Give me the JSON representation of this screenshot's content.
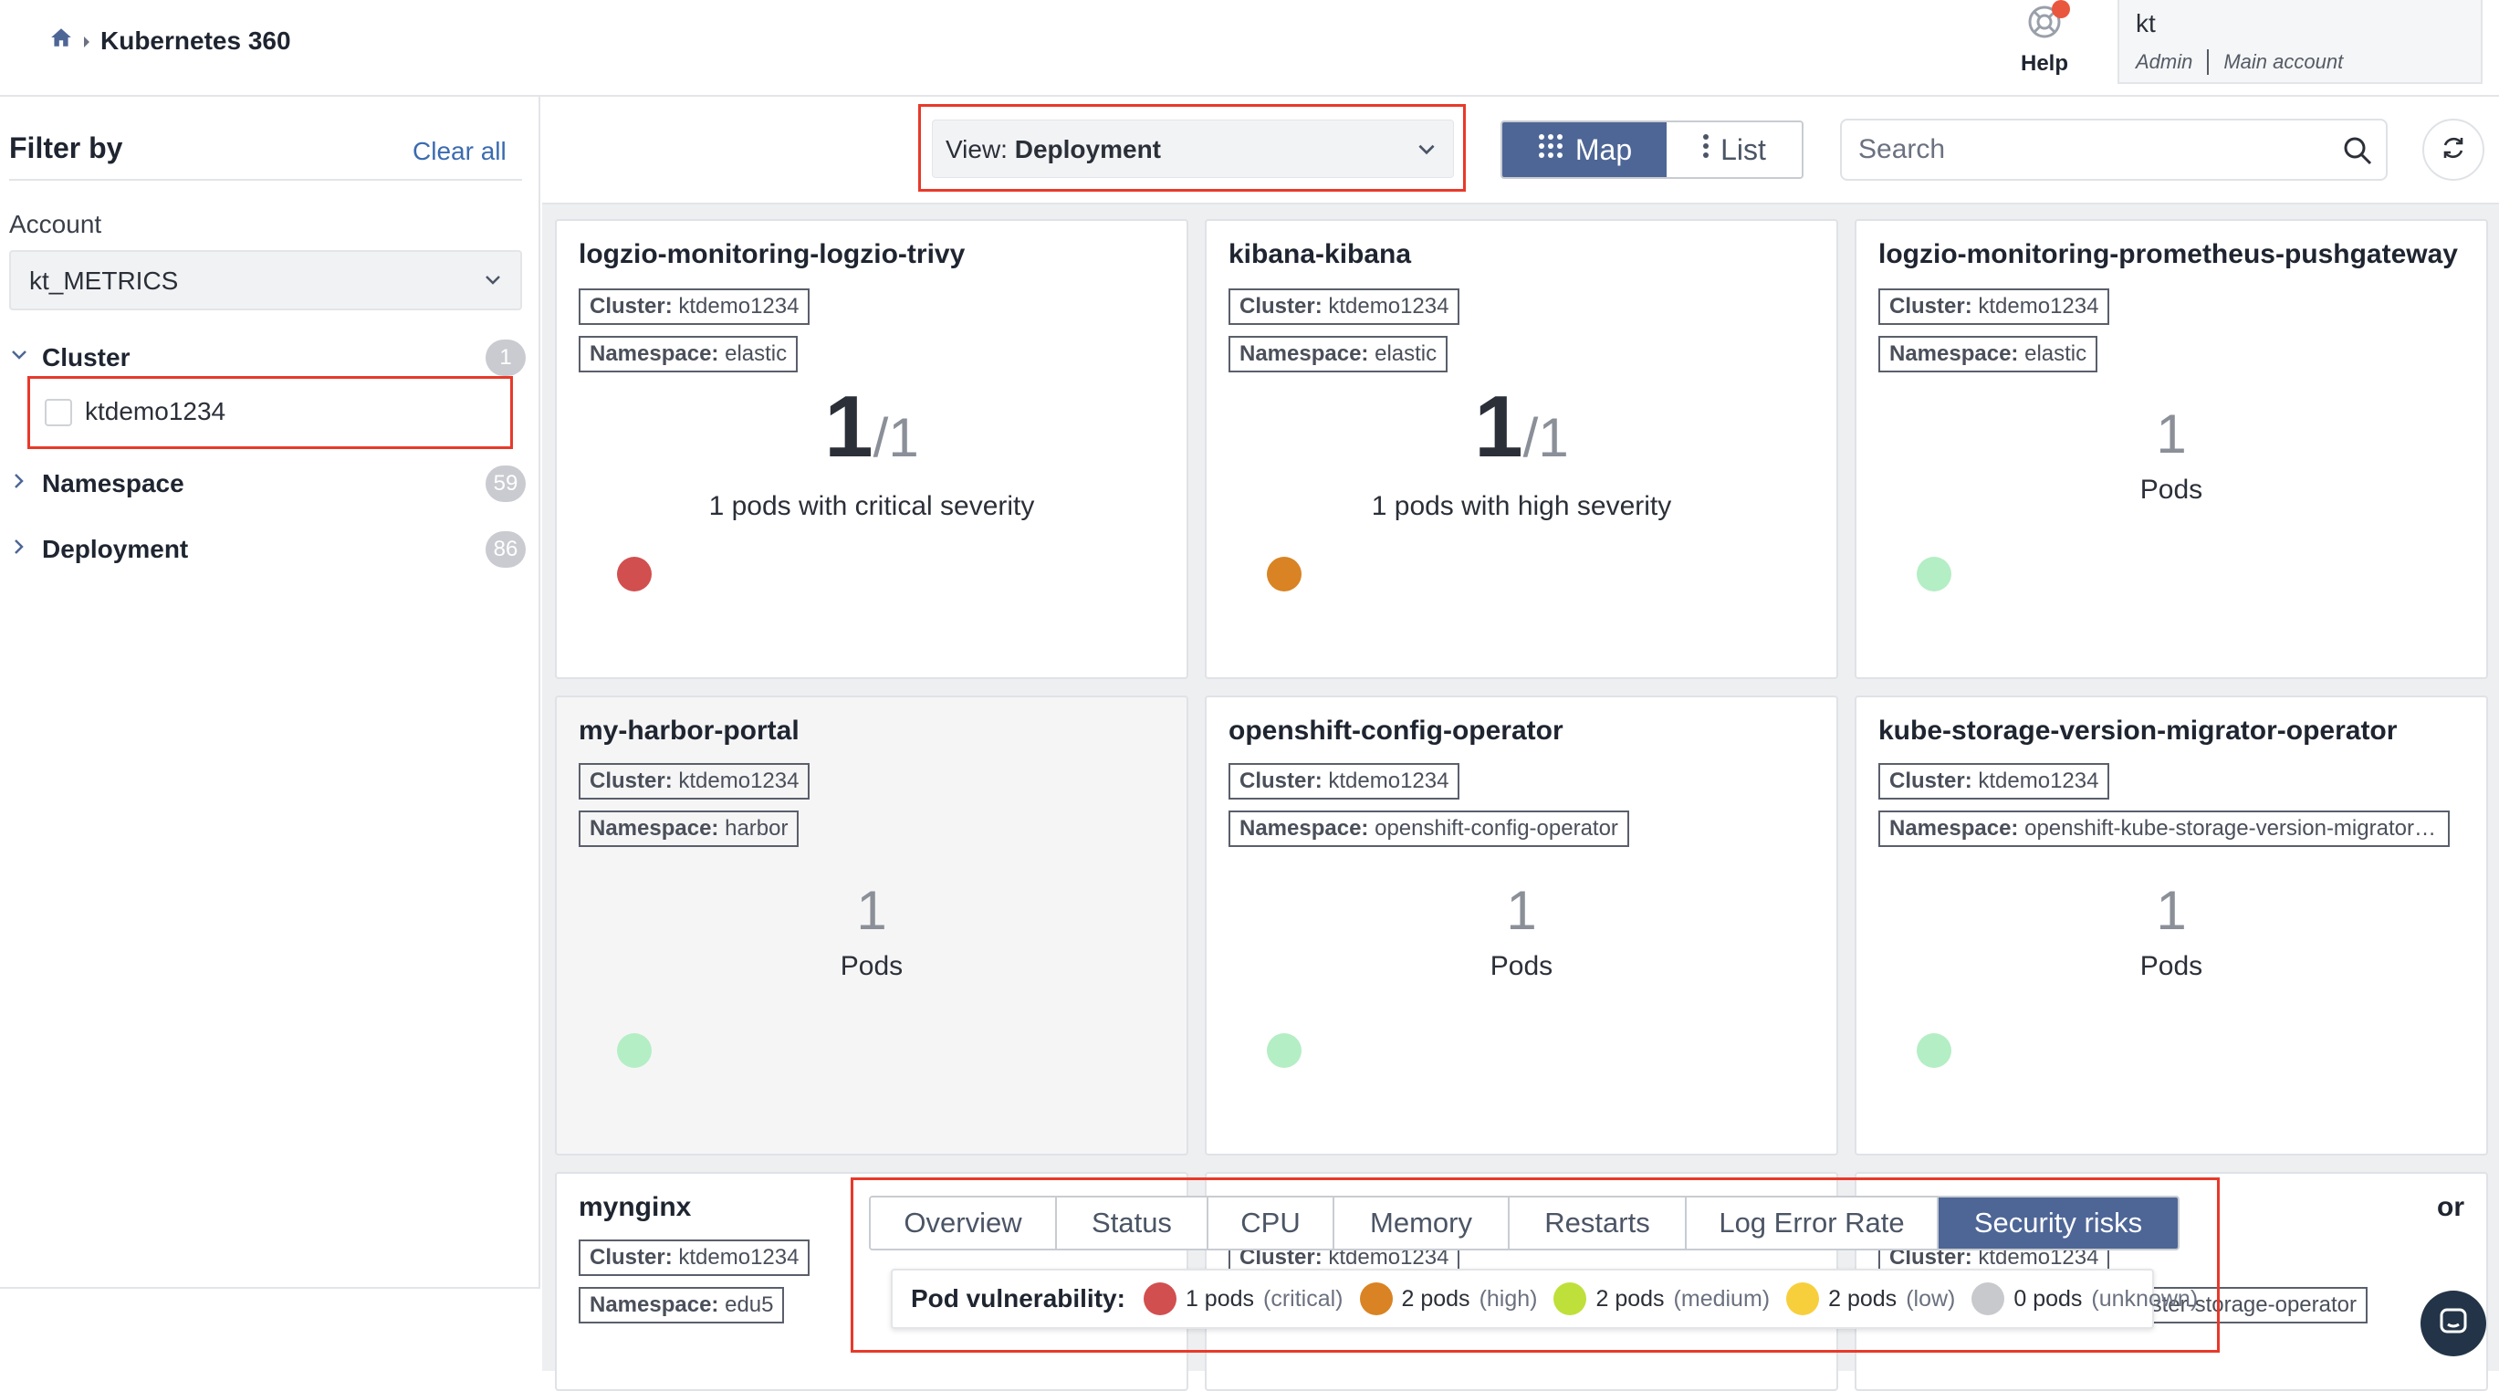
{
  "header": {
    "breadcrumb": "Kubernetes 360",
    "help_label": "Help",
    "user": {
      "name": "kt",
      "role": "Admin",
      "account": "Main account"
    }
  },
  "sidebar": {
    "title": "Filter by",
    "clear_all": "Clear all",
    "account_label": "Account",
    "account_value": "kt_METRICS",
    "groups": [
      {
        "name": "Cluster",
        "count": "1",
        "expanded": true,
        "items": [
          "ktdemo1234"
        ]
      },
      {
        "name": "Namespace",
        "count": "59",
        "expanded": false
      },
      {
        "name": "Deployment",
        "count": "86",
        "expanded": false
      }
    ]
  },
  "toolbar": {
    "view_prefix": "View:",
    "view_value": "Deployment",
    "map_label": "Map",
    "list_label": "List",
    "search_placeholder": "Search"
  },
  "tag_labels": {
    "cluster": "Cluster:",
    "namespace": "Namespace:"
  },
  "cards": [
    {
      "title": "logzio-monitoring-logzio-trivy",
      "cluster": "ktdemo1234",
      "namespace": "elastic",
      "big": "1",
      "frac": "/1",
      "text": "1 pods with critical severity",
      "dot_color": "#d24f4f"
    },
    {
      "title": "kibana-kibana",
      "cluster": "ktdemo1234",
      "namespace": "elastic",
      "big": "1",
      "frac": "/1",
      "text": "1 pods with high severity",
      "dot_color": "#d98324"
    },
    {
      "title": "logzio-monitoring-prometheus-pushgateway",
      "cluster": "ktdemo1234",
      "namespace": "elastic",
      "pods": "1",
      "pods_label": "Pods",
      "dot_color": "#b4eec4"
    },
    {
      "title": "my-harbor-portal",
      "cluster": "ktdemo1234",
      "namespace": "harbor",
      "pods": "1",
      "pods_label": "Pods",
      "dot_color": "#b4eec4"
    },
    {
      "title": "openshift-config-operator",
      "cluster": "ktdemo1234",
      "namespace": "openshift-config-operator",
      "pods": "1",
      "pods_label": "Pods",
      "dot_color": "#b4eec4"
    },
    {
      "title": "kube-storage-version-migrator-operator",
      "cluster": "ktdemo1234",
      "namespace": "openshift-kube-storage-version-migrator-operator",
      "pods": "1",
      "pods_label": "Pods",
      "dot_color": "#b4eec4"
    },
    {
      "title": "mynginx",
      "cluster": "ktdemo1234",
      "namespace": "edu5"
    },
    {
      "title": "",
      "cluster": "ktdemo1234",
      "namespace": ""
    },
    {
      "title": "or",
      "cluster": "ktdemo1234",
      "namespace": "ster-storage-operator"
    }
  ],
  "bottom_tabs": [
    "Overview",
    "Status",
    "CPU",
    "Memory",
    "Restarts",
    "Log Error Rate",
    "Security risks"
  ],
  "active_tab": "Security risks",
  "legend": {
    "title": "Pod vulnerability:",
    "items": [
      {
        "count": "1 pods",
        "severity": "(critical)",
        "color": "#d24f4f"
      },
      {
        "count": "2 pods",
        "severity": "(high)",
        "color": "#d98324"
      },
      {
        "count": "2 pods",
        "severity": "(medium)",
        "color": "#bfe03a"
      },
      {
        "count": "2 pods",
        "severity": "(low)",
        "color": "#f7cf3d"
      },
      {
        "count": "0 pods",
        "severity": "(unknown)",
        "color": "#c8c9cc"
      }
    ]
  },
  "colors": {
    "accent": "#4e6696",
    "highlight_frame": "#e8392a"
  },
  "icons": [
    "home-icon",
    "caret-right-icon",
    "help-icon",
    "chevron-down-icon",
    "grid-icon",
    "kebab-icon",
    "search-icon",
    "refresh-icon",
    "chat-icon"
  ]
}
